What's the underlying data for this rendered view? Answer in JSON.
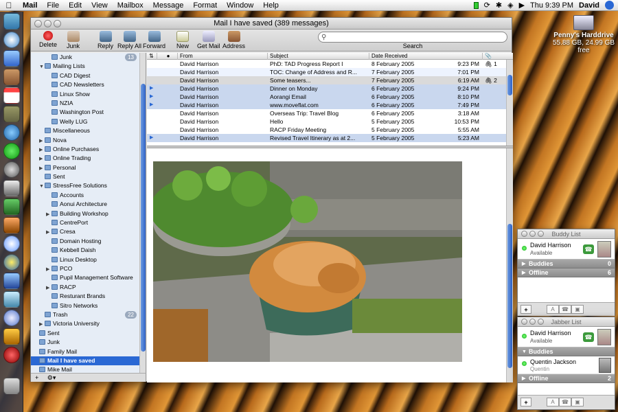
{
  "menubar": {
    "app": "Mail",
    "items": [
      "File",
      "Edit",
      "View",
      "Mailbox",
      "Message",
      "Format",
      "Window",
      "Help"
    ],
    "clock": "Thu 9:39 PM",
    "user": "David"
  },
  "desktop": {
    "hd_name": "Penny's Harddrive",
    "hd_info": "55.88 GB, 24.99 GB free"
  },
  "window": {
    "title": "Mail I have saved (389 messages)"
  },
  "toolbar": {
    "delete": "Delete",
    "junk": "Junk",
    "reply": "Reply",
    "reply_all": "Reply All",
    "forward": "Forward",
    "new": "New",
    "get_mail": "Get Mail",
    "address": "Address",
    "search_label": "Search",
    "search_value": ""
  },
  "sidebar": {
    "items": [
      {
        "label": "Junk",
        "indent": 2,
        "tri": "",
        "badge": "13"
      },
      {
        "label": "Mailing Lists",
        "indent": 1,
        "tri": "▼",
        "badge": ""
      },
      {
        "label": "CAD Digest",
        "indent": 2,
        "tri": "",
        "badge": ""
      },
      {
        "label": "CAD Newsletters",
        "indent": 2,
        "tri": "",
        "badge": ""
      },
      {
        "label": "Linux Show",
        "indent": 2,
        "tri": "",
        "badge": ""
      },
      {
        "label": "NZIA",
        "indent": 2,
        "tri": "",
        "badge": ""
      },
      {
        "label": "Washington Post",
        "indent": 2,
        "tri": "",
        "badge": ""
      },
      {
        "label": "Welly LUG",
        "indent": 2,
        "tri": "",
        "badge": ""
      },
      {
        "label": "Miscellaneous",
        "indent": 1,
        "tri": "",
        "badge": ""
      },
      {
        "label": "Nova",
        "indent": 1,
        "tri": "▶",
        "badge": ""
      },
      {
        "label": "Online Purchases",
        "indent": 1,
        "tri": "▶",
        "badge": ""
      },
      {
        "label": "Online Trading",
        "indent": 1,
        "tri": "▶",
        "badge": ""
      },
      {
        "label": "Personal",
        "indent": 1,
        "tri": "▶",
        "badge": ""
      },
      {
        "label": "Sent",
        "indent": 1,
        "tri": "",
        "badge": ""
      },
      {
        "label": "StressFree Solutions",
        "indent": 1,
        "tri": "▼",
        "badge": ""
      },
      {
        "label": "Accounts",
        "indent": 2,
        "tri": "",
        "badge": ""
      },
      {
        "label": "Aonui Architecture",
        "indent": 2,
        "tri": "",
        "badge": ""
      },
      {
        "label": "Building Workshop",
        "indent": 2,
        "tri": "▶",
        "badge": ""
      },
      {
        "label": "CentrePort",
        "indent": 2,
        "tri": "",
        "badge": ""
      },
      {
        "label": "Cresa",
        "indent": 2,
        "tri": "▶",
        "badge": ""
      },
      {
        "label": "Domain Hosting",
        "indent": 2,
        "tri": "",
        "badge": ""
      },
      {
        "label": "Kebbell Daish",
        "indent": 2,
        "tri": "",
        "badge": ""
      },
      {
        "label": "Linux Desktop",
        "indent": 2,
        "tri": "",
        "badge": ""
      },
      {
        "label": "PCO",
        "indent": 2,
        "tri": "▶",
        "badge": ""
      },
      {
        "label": "Pupil Management Software",
        "indent": 2,
        "tri": "",
        "badge": ""
      },
      {
        "label": "RACP",
        "indent": 2,
        "tri": "▶",
        "badge": ""
      },
      {
        "label": "Resturant Brands",
        "indent": 2,
        "tri": "",
        "badge": ""
      },
      {
        "label": "Sitro Networks",
        "indent": 2,
        "tri": "",
        "badge": ""
      },
      {
        "label": "Trash",
        "indent": 1,
        "tri": "",
        "badge": "22"
      },
      {
        "label": "Victoria University",
        "indent": 1,
        "tri": "▶",
        "badge": ""
      },
      {
        "label": "Sent",
        "indent": 0,
        "tri": "",
        "badge": ""
      },
      {
        "label": "Junk",
        "indent": 0,
        "tri": "",
        "badge": ""
      },
      {
        "label": "Family Mail",
        "indent": 0,
        "tri": "",
        "badge": ""
      },
      {
        "label": "Mail I have saved",
        "indent": 0,
        "tri": "",
        "badge": "",
        "selected": true
      },
      {
        "label": "Mike Mail",
        "indent": 0,
        "tri": "",
        "badge": ""
      }
    ]
  },
  "message_list": {
    "columns": {
      "from": "From",
      "subject": "Subject",
      "date": "Date Received"
    },
    "rows": [
      {
        "unread": false,
        "from": "David Harrison",
        "subject": "PhD: TAD Progress Report I",
        "date": "8 February 2005",
        "time": "9:23 PM",
        "attach": "1",
        "style": ""
      },
      {
        "unread": false,
        "from": "David Harrison",
        "subject": "TOC: Change of Address and R...",
        "date": "7 February 2005",
        "time": "7:01 PM",
        "attach": "",
        "style": "alt"
      },
      {
        "unread": false,
        "from": "David Harrison",
        "subject": "Some teasers...",
        "date": "7 February 2005",
        "time": "6:19 AM",
        "attach": "2",
        "style": "hl"
      },
      {
        "unread": true,
        "from": "David Harrison",
        "subject": "Dinner on Monday",
        "date": "6 February 2005",
        "time": "9:24 PM",
        "attach": "",
        "style": "sel"
      },
      {
        "unread": true,
        "from": "David Harrison",
        "subject": "Aorangi Email",
        "date": "6 February 2005",
        "time": "8:10 PM",
        "attach": "",
        "style": "sel"
      },
      {
        "unread": true,
        "from": "David Harrison",
        "subject": "www.moveflat.com",
        "date": "6 February 2005",
        "time": "7:49 PM",
        "attach": "",
        "style": "sel"
      },
      {
        "unread": false,
        "from": "David Harrison",
        "subject": "Overseas Trip: Travel Blog",
        "date": "6 February 2005",
        "time": "3:18 AM",
        "attach": "",
        "style": ""
      },
      {
        "unread": false,
        "from": "David Harrison",
        "subject": "Hello",
        "date": "5 February 2005",
        "time": "10:53 PM",
        "attach": "",
        "style": ""
      },
      {
        "unread": false,
        "from": "David Harrison",
        "subject": "RACP Friday Meeting",
        "date": "5 February 2005",
        "time": "5:55 AM",
        "attach": "",
        "style": ""
      },
      {
        "unread": true,
        "from": "David Harrison",
        "subject": "Revised Travel Itinerary as at 2...",
        "date": "5 February 2005",
        "time": "5:23 AM",
        "attach": "",
        "style": "sel"
      }
    ]
  },
  "buddy_list": {
    "title": "Buddy List",
    "self_name": "David Harrison",
    "self_status": "Available",
    "groups": [
      {
        "name": "Buddies",
        "count": "0"
      },
      {
        "name": "Offline",
        "count": "6"
      }
    ]
  },
  "jabber_list": {
    "title": "Jabber List",
    "self_name": "David Harrison",
    "self_status": "Available",
    "group_buddies": "Buddies",
    "buddy_name": "Quentin Jackson",
    "buddy_status": "Quentin",
    "group_offline": "Offline",
    "offline_count": "2"
  }
}
